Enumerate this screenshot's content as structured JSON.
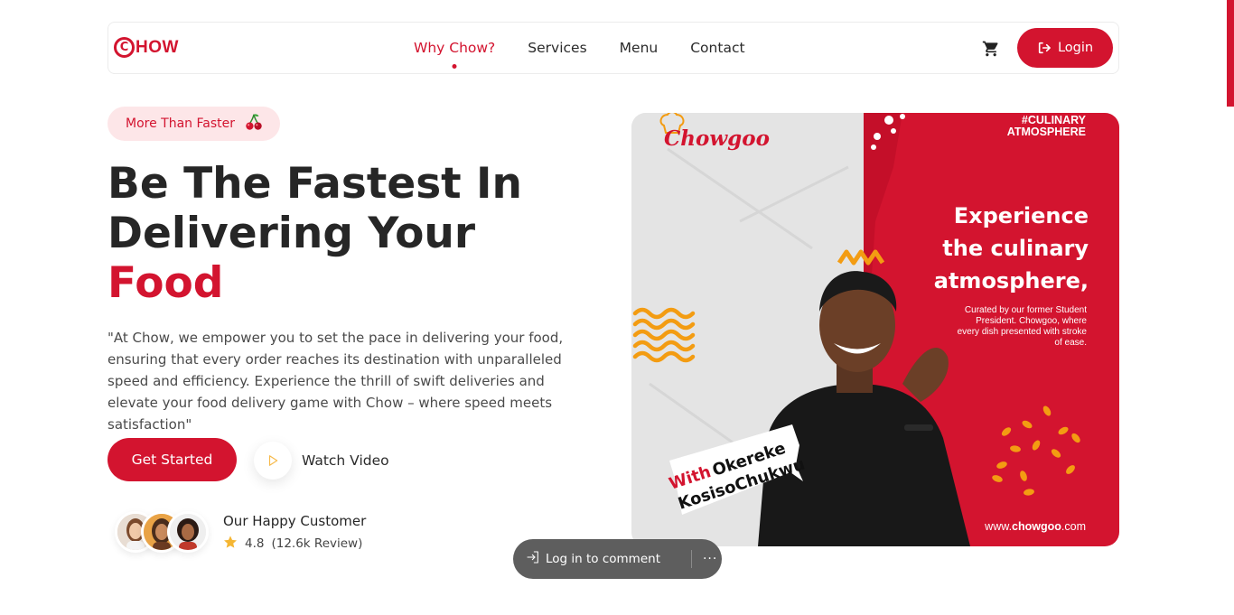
{
  "brand": {
    "logo_letter": "C",
    "logo_rest": "HOW",
    "accent_color": "#d3142f"
  },
  "nav": {
    "links": [
      {
        "label": "Why Chow?",
        "active": true
      },
      {
        "label": "Services",
        "active": false
      },
      {
        "label": "Menu",
        "active": false
      },
      {
        "label": "Contact",
        "active": false
      }
    ],
    "cart_icon": "cart-icon",
    "login_label": "Login",
    "login_icon": "login-arrow-icon"
  },
  "hero": {
    "tag": "More Than Faster",
    "tag_icon": "cherry-icon",
    "headline_line1": "Be The Fastest In",
    "headline_line2": "Delivering Your",
    "headline_highlight": "Food",
    "description": "\"At Chow, we empower you to set the pace in delivering your food, ensuring that every order reaches its destination with unparalleled speed and efficiency. Experience the thrill of swift deliveries and elevate your food delivery game with Chow – where speed meets satisfaction\"",
    "cta_primary": "Get Started",
    "cta_secondary": "Watch Video",
    "cta_secondary_icon": "play-icon"
  },
  "customers": {
    "title": "Our Happy Customer",
    "rating": "4.8",
    "reviews": "(12.6k Review)",
    "star_icon": "star-icon"
  },
  "promo": {
    "brand": "Chowgoo",
    "hashtag_line1": "#CULINARY",
    "hashtag_line2": "ATMOSPHERE",
    "heading_line1": "Experience",
    "heading_line2": "the culinary",
    "heading_line3": "atmosphere,",
    "sub_line1": "Curated by our former Student",
    "sub_line2": "President. Chowgoo, where",
    "sub_line3": "every dish presented with stroke",
    "sub_line4": "of ease.",
    "bubble_with": "With",
    "bubble_name1": "Okereke",
    "bubble_name2": "KosisoChukwu",
    "website_prefix": "www.",
    "website_bold": "chowgoo",
    "website_suffix": ".com",
    "red": "#d3142f",
    "orange": "#f39c12"
  },
  "comment_bar": {
    "label": "Log in to comment",
    "more": "···"
  }
}
